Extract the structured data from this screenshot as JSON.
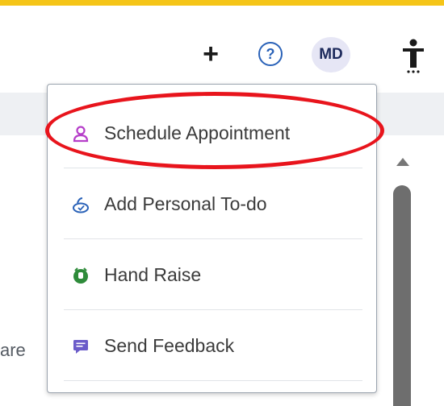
{
  "header": {
    "add_glyph": "+",
    "help_glyph": "?",
    "avatar_initials": "MD"
  },
  "background": {
    "partial_text": "are"
  },
  "menu": {
    "items": [
      {
        "label": "Schedule Appointment",
        "icon": "person-icon",
        "icon_color": "#b63fc9"
      },
      {
        "label": "Add Personal To-do",
        "icon": "todo-icon",
        "icon_color": "#2a62b8"
      },
      {
        "label": "Hand Raise",
        "icon": "hand-raise-icon",
        "icon_color": "#2e8b3a"
      },
      {
        "label": "Send Feedback",
        "icon": "feedback-icon",
        "icon_color": "#6b5cc9"
      }
    ]
  },
  "colors": {
    "top_stripe": "#f5c518",
    "highlight": "#e8141c",
    "accent_blue": "#2a62b8"
  }
}
